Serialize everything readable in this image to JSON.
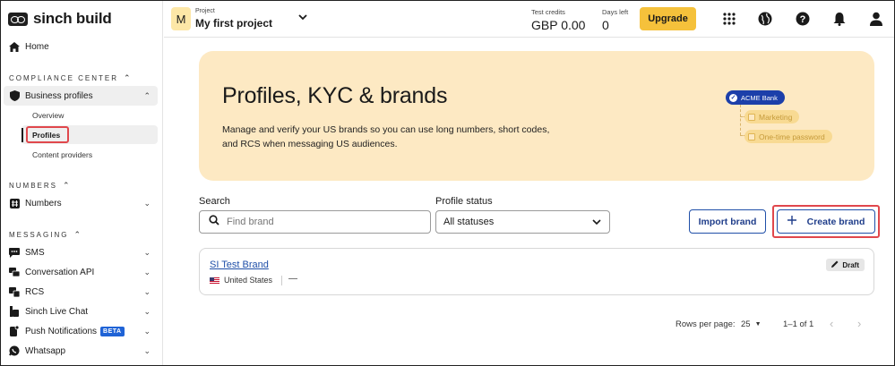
{
  "app": {
    "logo_text": "sinch build"
  },
  "sidebar": {
    "home": "Home",
    "compliance": {
      "title": "COMPLIANCE CENTER",
      "business_profiles": "Business profiles",
      "overview": "Overview",
      "profiles": "Profiles",
      "content_providers": "Content providers"
    },
    "numbers": {
      "title": "NUMBERS",
      "item": "Numbers"
    },
    "messaging": {
      "title": "MESSAGING",
      "items": [
        "SMS",
        "Conversation API",
        "RCS",
        "Sinch Live Chat",
        "Push Notifications",
        "Whatsapp"
      ],
      "beta": "BETA"
    }
  },
  "header": {
    "project_avatar": "M",
    "project_label": "Project",
    "project_name": "My first project",
    "credits_label": "Test credits",
    "credits_value": "GBP 0.00",
    "days_label": "Days left",
    "days_value": "0",
    "upgrade": "Upgrade",
    "icons": [
      "apps-grid-icon",
      "globe-icon",
      "help-icon",
      "bell-icon",
      "user-icon"
    ]
  },
  "banner": {
    "title": "Profiles, KYC & brands",
    "description": "Manage and verify your US brands so you can use long numbers, short codes, and RCS when messaging US audiences.",
    "illustration": {
      "brand": "ACME Bank",
      "children": [
        "Marketing",
        "One-time password"
      ]
    }
  },
  "filters": {
    "search_label": "Search",
    "search_placeholder": "Find brand",
    "status_label": "Profile status",
    "status_value": "All statuses"
  },
  "actions": {
    "import": "Import brand",
    "create": "Create brand"
  },
  "brands": [
    {
      "name": "SI Test Brand",
      "country": "United States",
      "extra": "—",
      "status": "Draft"
    }
  ],
  "pagination": {
    "rows_label": "Rows per page:",
    "rows_value": "25",
    "range": "1–1 of 1"
  },
  "colors": {
    "accent": "#f5c13b",
    "banner": "#fde9c3",
    "link": "#1f4fa8",
    "highlight": "#e0474c"
  }
}
